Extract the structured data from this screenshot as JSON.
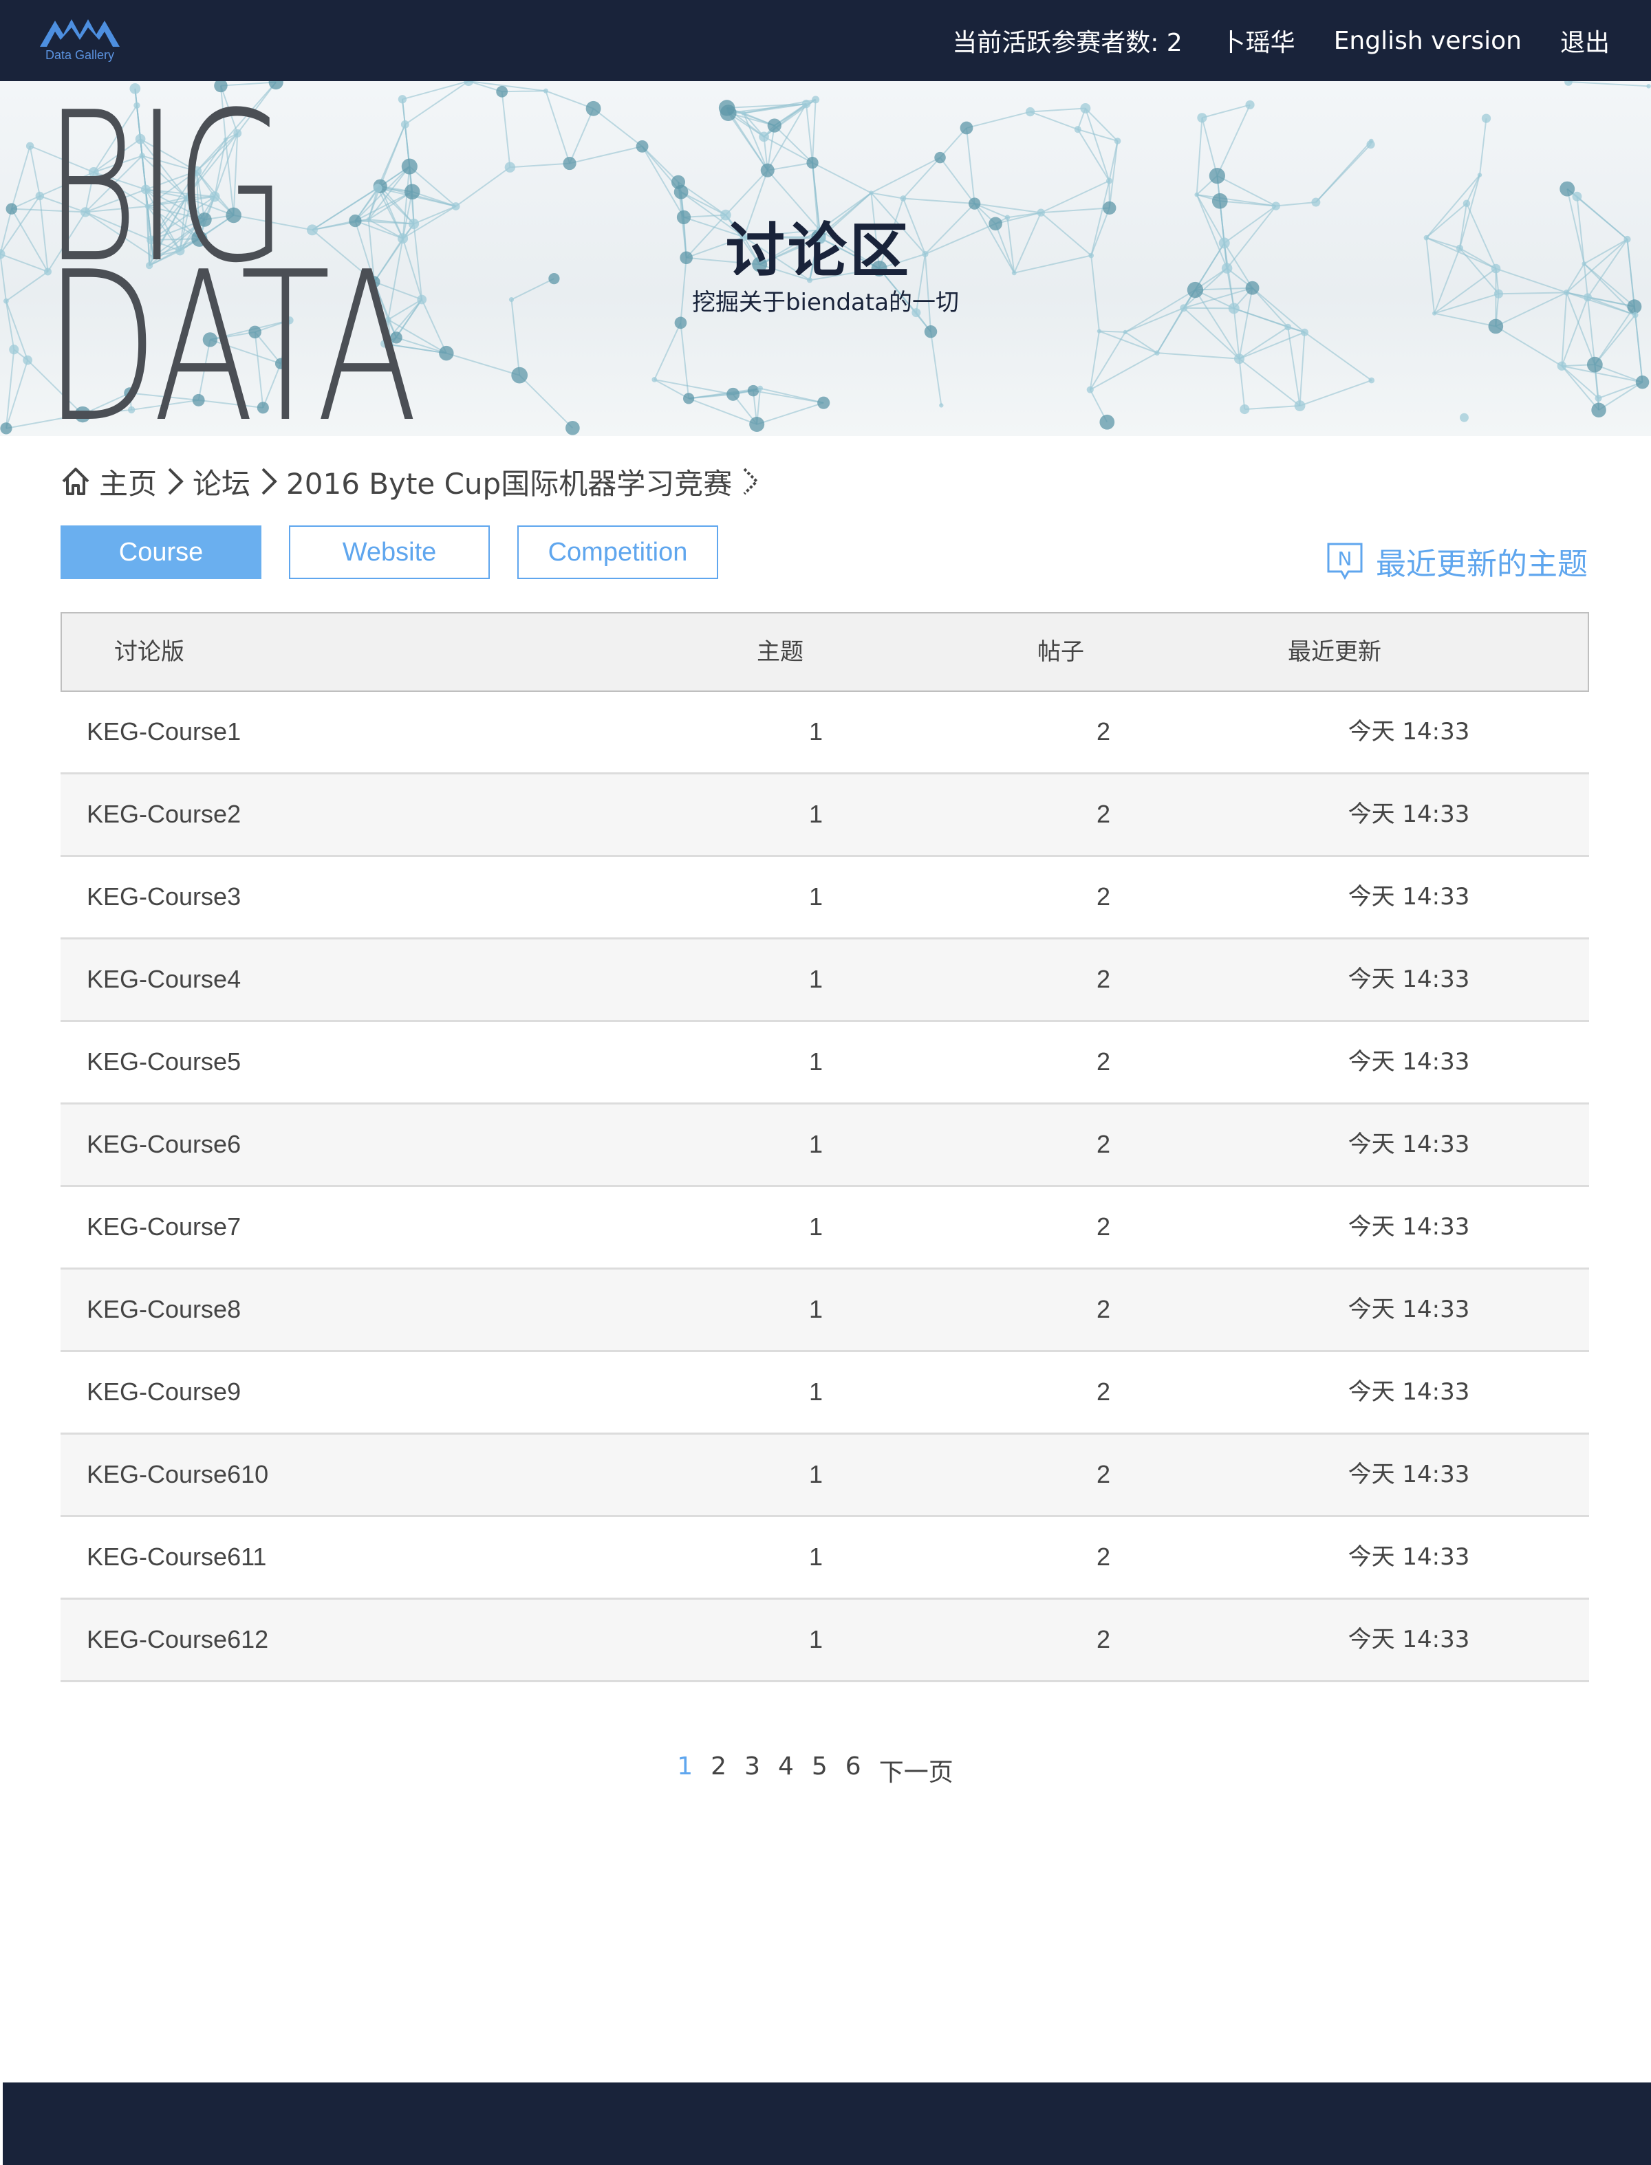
{
  "header": {
    "logo_text": "Data Gallery",
    "active_participants": "当前活跃参赛者数: 2",
    "user_name": "卜瑶华",
    "english_version": "English version",
    "logout": "退出"
  },
  "banner": {
    "big_line1": "BIG",
    "big_line2": "DATA",
    "title": "讨论区",
    "subtitle": "挖掘关于biendata的一切"
  },
  "breadcrumb": {
    "home": "主页",
    "forum": "论坛",
    "competition": "2016 Byte Cup国际机器学习竞赛"
  },
  "tabs": [
    {
      "label": "Course",
      "active": true
    },
    {
      "label": "Website",
      "active": false
    },
    {
      "label": "Competition",
      "active": false
    }
  ],
  "recent_topics": "最近更新的主题",
  "recent_icon_letter": "N",
  "table": {
    "headers": {
      "board": "讨论版",
      "topics": "主题",
      "posts": "帖子",
      "updated": "最近更新"
    },
    "rows": [
      {
        "name": "KEG-Course1",
        "topics": "1",
        "posts": "2",
        "updated": "今天 14:33"
      },
      {
        "name": "KEG-Course2",
        "topics": "1",
        "posts": "2",
        "updated": "今天 14:33"
      },
      {
        "name": "KEG-Course3",
        "topics": "1",
        "posts": "2",
        "updated": "今天 14:33"
      },
      {
        "name": "KEG-Course4",
        "topics": "1",
        "posts": "2",
        "updated": "今天 14:33"
      },
      {
        "name": "KEG-Course5",
        "topics": "1",
        "posts": "2",
        "updated": "今天 14:33"
      },
      {
        "name": "KEG-Course6",
        "topics": "1",
        "posts": "2",
        "updated": "今天 14:33"
      },
      {
        "name": "KEG-Course7",
        "topics": "1",
        "posts": "2",
        "updated": "今天 14:33"
      },
      {
        "name": "KEG-Course8",
        "topics": "1",
        "posts": "2",
        "updated": "今天 14:33"
      },
      {
        "name": "KEG-Course9",
        "topics": "1",
        "posts": "2",
        "updated": "今天 14:33"
      },
      {
        "name": "KEG-Course610",
        "topics": "1",
        "posts": "2",
        "updated": "今天 14:33"
      },
      {
        "name": "KEG-Course611",
        "topics": "1",
        "posts": "2",
        "updated": "今天 14:33"
      },
      {
        "name": "KEG-Course612",
        "topics": "1",
        "posts": "2",
        "updated": "今天 14:33"
      }
    ]
  },
  "pagination": {
    "current": "1",
    "pages": [
      "2",
      "3",
      "4",
      "5",
      "6"
    ],
    "next": "下一页"
  },
  "colors": {
    "nav_bg": "#19233a",
    "accent": "#5fa6ee",
    "active_tab": "#6aafef"
  }
}
